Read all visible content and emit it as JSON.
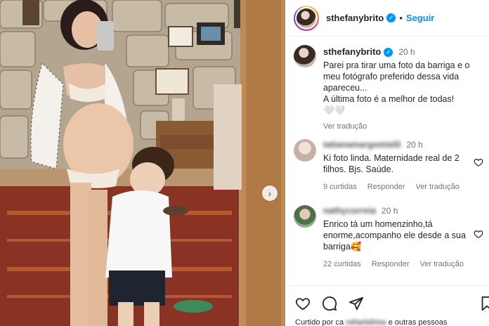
{
  "post": {
    "username": "sthefanybrito",
    "follow_label": "Seguir",
    "separator": "•",
    "caption_username": "sthefanybrito",
    "caption_time": "20 h",
    "caption_text": "Parei pra tirar uma foto da barriga e o meu fotógrafo preferido dessa vida apareceu...\nA última foto é a melhor de todas!\n🤍🤍",
    "see_translation": "Ver tradução"
  },
  "comments": [
    {
      "username": "tatianamargomielli",
      "time": "20 h",
      "text": "Ki foto linda. Maternidade real de 2 filhos. Bjs. Saúde.",
      "likes": "9 curtidas",
      "reply": "Responder",
      "translate": "Ver tradução"
    },
    {
      "username": "nathycorreia",
      "time": "20 h",
      "text": "Enrico tá um homenzinho,tá enorme,acompanho ele desde a sua barriga🥰",
      "likes": "22 curtidas",
      "reply": "Responder",
      "translate": "Ver tradução"
    }
  ],
  "footer": {
    "liked_prefix": "Curtido por ca",
    "liked_blurred": "rafaelalima",
    "liked_suffix": "e outras pessoas"
  },
  "icons": {
    "verified": "verified-badge-icon",
    "heart": "heart-icon",
    "comment": "comment-icon",
    "share": "share-icon",
    "bookmark": "bookmark-icon",
    "next": "chevron-right-icon"
  },
  "colors": {
    "accent": "#0095f6",
    "muted": "#737373",
    "text": "#262626"
  }
}
